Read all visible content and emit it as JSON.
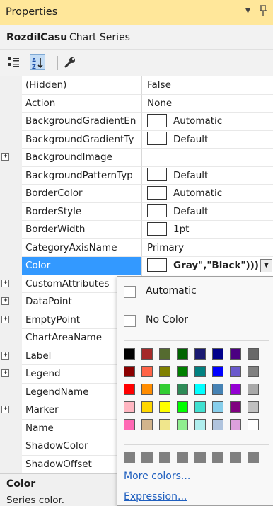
{
  "panel": {
    "title": "Properties"
  },
  "object": {
    "name": "RozdilCasu",
    "type": "Chart Series"
  },
  "toolbar": {
    "categorized_icon": "categorized-icon",
    "alphabetical_icon": "alphabetical-icon",
    "property_pages_icon": "wrench-icon"
  },
  "properties": [
    {
      "name": "(Hidden)",
      "value": "False"
    },
    {
      "name": "Action",
      "value": "None"
    },
    {
      "name": "BackgroundGradientEn",
      "value": "Automatic",
      "swatch": true
    },
    {
      "name": "BackgroundGradientTy",
      "value": "Default",
      "swatch": true
    },
    {
      "name": "BackgroundImage",
      "value": "",
      "expandable": true
    },
    {
      "name": "BackgroundPatternTyp",
      "value": "Default",
      "swatch": true
    },
    {
      "name": "BorderColor",
      "value": "Automatic",
      "swatch": true
    },
    {
      "name": "BorderStyle",
      "value": "Default",
      "swatch": true
    },
    {
      "name": "BorderWidth",
      "value": "1pt",
      "swatch": true,
      "swatch_line": true
    },
    {
      "name": "CategoryAxisName",
      "value": "Primary"
    },
    {
      "name": "Color",
      "value": "Gray\",\"Black\"))))",
      "swatch": true,
      "selected": true
    },
    {
      "name": "CustomAttributes",
      "value": "",
      "expandable": true
    },
    {
      "name": "DataPoint",
      "value": "",
      "expandable": true
    },
    {
      "name": "EmptyPoint",
      "value": "",
      "expandable": true
    },
    {
      "name": "ChartAreaName",
      "value": ""
    },
    {
      "name": "Label",
      "value": "",
      "expandable": true
    },
    {
      "name": "Legend",
      "value": "",
      "expandable": true
    },
    {
      "name": "LegendName",
      "value": ""
    },
    {
      "name": "Marker",
      "value": "",
      "expandable": true
    },
    {
      "name": "Name",
      "value": ""
    },
    {
      "name": "ShadowColor",
      "value": ""
    },
    {
      "name": "ShadowOffset",
      "value": ""
    }
  ],
  "description": {
    "title": "Color",
    "text": "Series color."
  },
  "color_popup": {
    "automatic_label": "Automatic",
    "nocolor_label": "No Color",
    "more_colors": "More colors...",
    "expression": "Expression...",
    "palette": [
      [
        "#000000",
        "#a52a2a",
        "#556b2f",
        "#006400",
        "#191970",
        "#00008b",
        "#4b0082",
        "#696969"
      ],
      [
        "#8b0000",
        "#ff6347",
        "#808000",
        "#008000",
        "#008080",
        "#0000ff",
        "#6a5acd",
        "#808080"
      ],
      [
        "#ff0000",
        "#ff8c00",
        "#32cd32",
        "#2e8b57",
        "#00ffff",
        "#4682b4",
        "#9400d3",
        "#a9a9a9"
      ],
      [
        "#ffb6c1",
        "#ffd700",
        "#ffff00",
        "#00ff00",
        "#40e0d0",
        "#87ceeb",
        "#800080",
        "#c0c0c0"
      ],
      [
        "#ff69b4",
        "#d2b48c",
        "#f0e68c",
        "#90ee90",
        "#afeeee",
        "#b0c4de",
        "#dda0dd",
        "#ffffff"
      ]
    ],
    "recent": [
      "#808080",
      "#808080",
      "#808080",
      "#808080",
      "#808080",
      "#808080",
      "#808080",
      "#808080"
    ]
  }
}
